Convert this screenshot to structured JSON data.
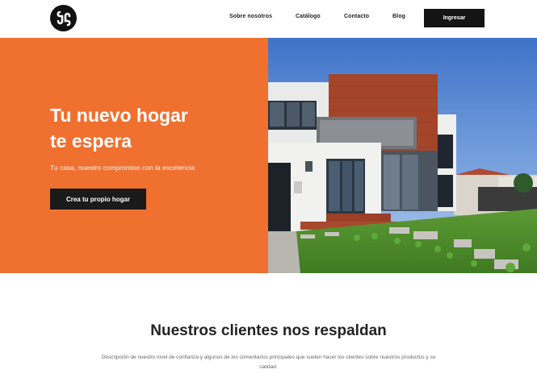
{
  "header": {
    "nav": [
      {
        "label": "Sobre nosotros"
      },
      {
        "label": "Catálogo"
      },
      {
        "label": "Contacto"
      },
      {
        "label": "Blog"
      }
    ],
    "login_label": "Ingresar",
    "logo_icon": "brand-logo-icon"
  },
  "hero": {
    "title_line1": "Tu nuevo hogar",
    "title_line2": "te espera",
    "subtitle": "Tu casa, nuestro compromiso con la excelencia",
    "cta_label": "Crea tu propio hogar",
    "background_color": "#f07030",
    "image_icon": "modern-house-photo"
  },
  "testimonials": {
    "title": "Nuestros clientes nos respaldan",
    "description": "Descripción de nuestro nivel de confianza y algunos de los comentarios principales que suelen hacer los clientes sobre nuestros productos y su calidad."
  },
  "colors": {
    "accent": "#f07030",
    "dark": "#141414"
  }
}
